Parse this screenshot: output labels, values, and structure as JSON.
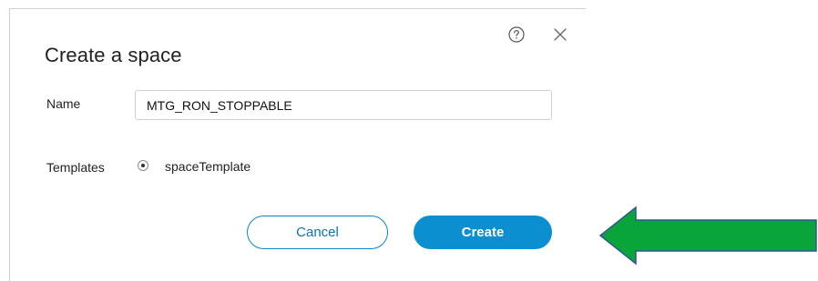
{
  "dialog": {
    "title": "Create a space",
    "help_icon": "question-circle-icon",
    "close_icon": "close-x-icon"
  },
  "form": {
    "name_label": "Name",
    "name_value": "MTG_RON_STOPPABLE",
    "templates_label": "Templates",
    "template_option": "spaceTemplate",
    "template_selected": true
  },
  "buttons": {
    "cancel_label": "Cancel",
    "create_label": "Create"
  },
  "annotation": {
    "arrow_icon": "left-arrow-icon",
    "colors": {
      "arrow_fill": "#0aa53a",
      "arrow_outline": "#2e5597"
    }
  },
  "colors": {
    "accent": "#0b8fd1",
    "cancel_border": "#0b86c9"
  }
}
